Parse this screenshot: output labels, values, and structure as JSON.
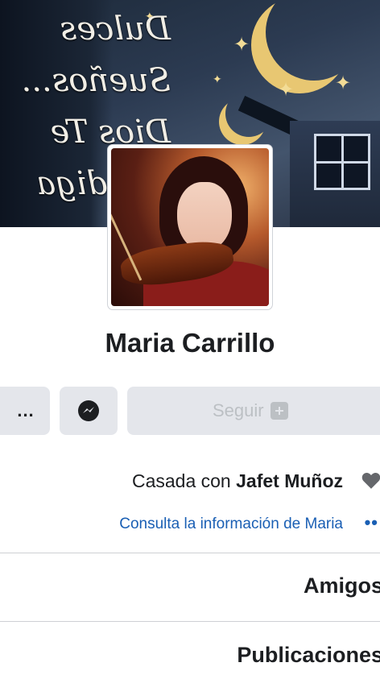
{
  "cover": {
    "overlay_text_lines": [
      "Dulces",
      "Sueños...",
      "Dios Te",
      "Bendiga"
    ]
  },
  "profile": {
    "name": "Maria Carrillo"
  },
  "actions": {
    "follow_label": "Seguir",
    "more_label": "...",
    "follow_icon": "add-friend-icon",
    "messenger_icon": "messenger-icon"
  },
  "status": {
    "prefix": "Casada con ",
    "partner": "Jafet Muñoz",
    "icon": "heart-icon"
  },
  "info_link": "Consulta la información de Maria",
  "info_more": "••",
  "sections": {
    "friends": "Amigos",
    "posts": "Publicaciones"
  },
  "colors": {
    "link": "#1a5fb4",
    "button_bg": "#e4e6eb",
    "disabled_text": "#bcc0c4"
  }
}
